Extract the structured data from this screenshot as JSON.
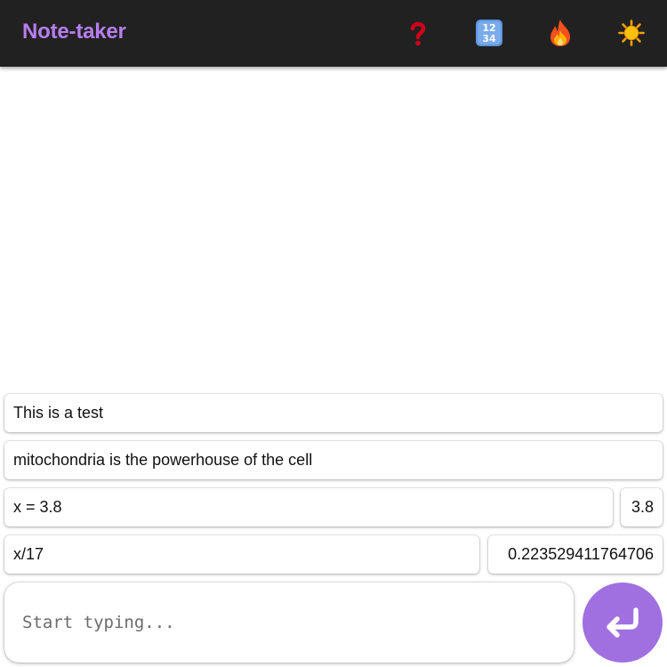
{
  "header": {
    "title": "Note-taker",
    "title_color": "#b77ef0",
    "background": "#212121",
    "buttons": [
      {
        "name": "help",
        "icon": "question-mark-icon",
        "color": "#d0021b"
      },
      {
        "name": "numbers",
        "icon": "numbers-1234-icon",
        "color": "#4a88d8"
      },
      {
        "name": "fire",
        "icon": "fire-icon",
        "color": "#f57c00"
      },
      {
        "name": "theme",
        "icon": "sun-icon",
        "color": "#ffb300"
      }
    ]
  },
  "notes": [
    {
      "text": "This is a test"
    },
    {
      "text": "mitochondria is the powerhouse of the cell"
    },
    {
      "text": "x = 3.8",
      "result": "3.8"
    },
    {
      "text": "x/17",
      "result": "0.223529411764706"
    }
  ],
  "input": {
    "placeholder": "Start typing...",
    "value": ""
  },
  "submit": {
    "icon": "enter-return-icon",
    "color": "#a070e0"
  }
}
